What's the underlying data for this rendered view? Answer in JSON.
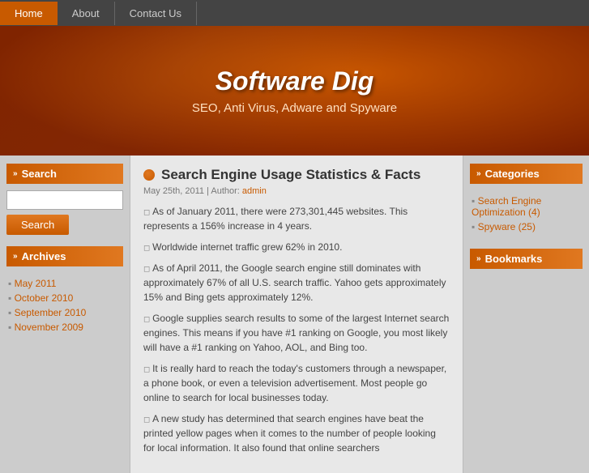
{
  "site": {
    "title": "Software Dig",
    "subtitle": "SEO, Anti Virus, Adware and Spyware"
  },
  "nav": {
    "items": [
      {
        "label": "Home",
        "active": true
      },
      {
        "label": "About",
        "active": false
      },
      {
        "label": "Contact Us",
        "active": false
      }
    ]
  },
  "left_sidebar": {
    "search_header": "Search",
    "search_placeholder": "",
    "search_button": "Search",
    "archives_header": "Archives",
    "archives": [
      {
        "label": "May 2011",
        "href": "#"
      },
      {
        "label": "October 2010",
        "href": "#"
      },
      {
        "label": "September 2010",
        "href": "#"
      },
      {
        "label": "November 2009",
        "href": "#"
      }
    ]
  },
  "main": {
    "post": {
      "title": "Search Engine Usage Statistics & Facts",
      "meta_date": "May 25th, 2011",
      "meta_author_label": "Author:",
      "meta_author": "admin",
      "paragraphs": [
        "As of January 2011, there were 273,301,445 websites. This represents a 156% increase in 4 years.",
        "Worldwide internet traffic grew 62% in 2010.",
        "As of April 2011, the Google search engine still dominates with approximately 67% of all U.S. search traffic. Yahoo gets approximately 15% and Bing gets approximately 12%.",
        "Google supplies search results to some of the largest Internet search engines. This means if you have #1 ranking on Google, you most likely will have a #1 ranking on Yahoo, AOL, and Bing too.",
        "It is really hard to reach the today's customers through a newspaper, a phone book, or even a television advertisement. Most people go online to search for local businesses today.",
        "A new study has determined that search engines have beat the printed yellow pages when it comes to the number of people looking for local information. It also found that online searchers"
      ]
    }
  },
  "right_sidebar": {
    "categories_header": "Categories",
    "categories": [
      {
        "label": "Search Engine Optimization (4)",
        "href": "#"
      },
      {
        "label": "Spyware (25)",
        "href": "#"
      }
    ],
    "bookmarks_header": "Bookmarks"
  }
}
